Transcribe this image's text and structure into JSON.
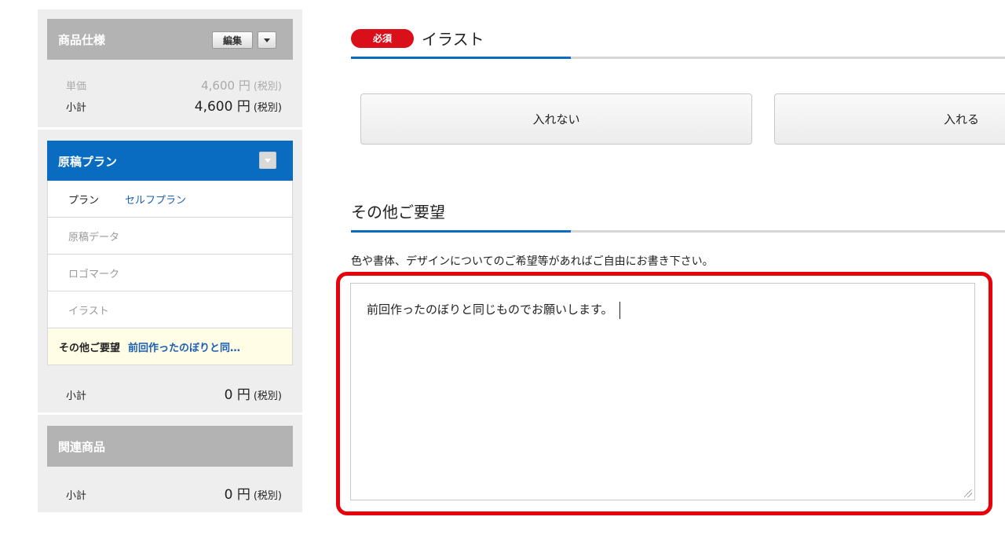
{
  "sidebar": {
    "spec": {
      "title": "商品仕様",
      "edit_label": "編集",
      "unit_price_label": "単価",
      "unit_price_value": "4,600 円",
      "unit_price_tax": "(税別)",
      "subtotal_label": "小計",
      "subtotal_value": "4,600 円",
      "subtotal_tax": "(税別)"
    },
    "plan": {
      "title": "原稿プラン",
      "items": [
        {
          "key": "プラン",
          "value": "セルフプラン"
        },
        {
          "key": "原稿データ",
          "value": ""
        },
        {
          "key": "ロゴマーク",
          "value": ""
        },
        {
          "key": "イラスト",
          "value": ""
        },
        {
          "key": "その他ご要望",
          "value": "前回作ったのぼりと同…"
        }
      ],
      "subtotal_label": "小計",
      "subtotal_value": "0 円",
      "subtotal_tax": "(税別)"
    },
    "related": {
      "title": "関連商品",
      "subtotal_label": "小計",
      "subtotal_value": "0 円",
      "subtotal_tax": "(税別)"
    }
  },
  "main": {
    "illustration": {
      "required_badge": "必須",
      "title": "イラスト",
      "options": [
        "入れない",
        "入れる"
      ]
    },
    "requests": {
      "title": "その他ご要望",
      "note": "色や書体、デザインについてのご希望等があればご自由にお書き下さい。",
      "value": "前回作ったのぼりと同じものでお願いします。"
    }
  },
  "colors": {
    "accent_blue": "#0a6cc0",
    "required_red": "#d9101a",
    "highlight_red": "#e8000b"
  }
}
